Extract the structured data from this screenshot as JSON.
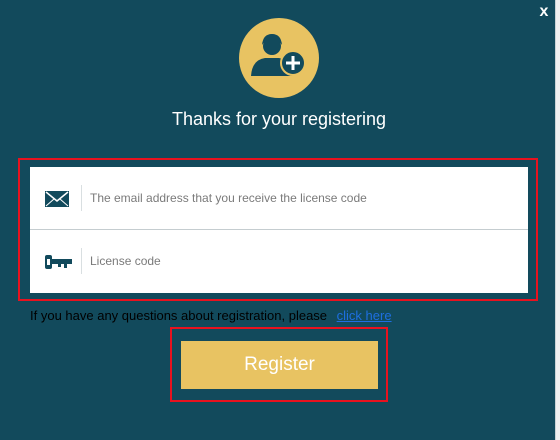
{
  "dialog": {
    "close_label": "x",
    "title": "Thanks for your registering",
    "avatar_icon": "user-add-icon",
    "accent_color": "#e8c362",
    "background_color": "#124a5c"
  },
  "fields": {
    "email": {
      "icon": "envelope-icon",
      "placeholder": "The email address that you receive the license code",
      "value": ""
    },
    "license": {
      "icon": "key-icon",
      "placeholder": "License code",
      "value": ""
    }
  },
  "help": {
    "text": "If you have any questions about registration, please",
    "link_label": "click here"
  },
  "register_button": {
    "label": "Register"
  }
}
